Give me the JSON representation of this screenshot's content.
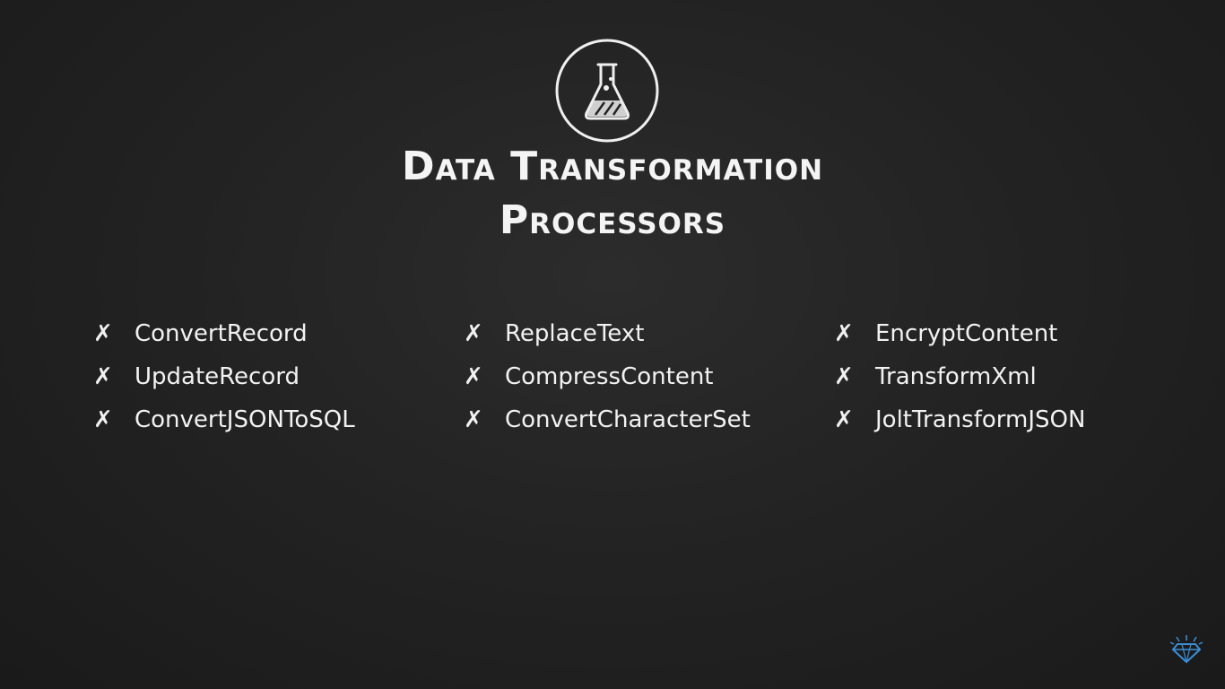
{
  "title": {
    "line1": "Data Transformation",
    "line2": "Processors"
  },
  "icons": {
    "header": "flask-icon",
    "list_marker": "x-mark-icon",
    "brand": "diamond-logo-icon"
  },
  "colors": {
    "background": "#232323",
    "text": "#f2f2f2",
    "brand": "#3b8fd6"
  },
  "columns": [
    {
      "items": [
        "ConvertRecord",
        "UpdateRecord",
        "ConvertJSONToSQL"
      ]
    },
    {
      "items": [
        "ReplaceText",
        "CompressContent",
        "ConvertCharacterSet"
      ]
    },
    {
      "items": [
        "EncryptContent",
        "TransformXml",
        "JoltTransformJSON"
      ]
    }
  ],
  "marker": "✗"
}
